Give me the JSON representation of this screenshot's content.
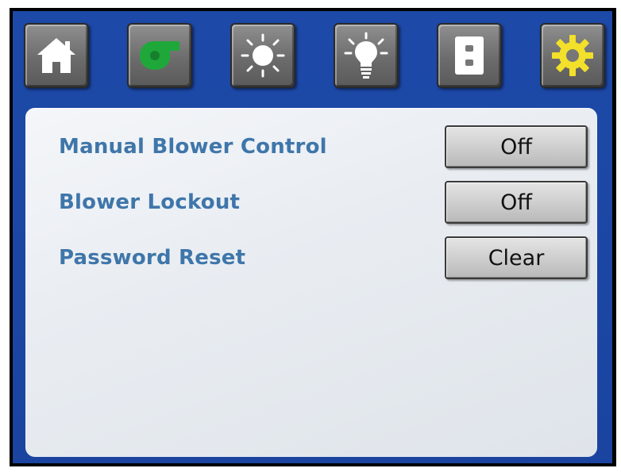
{
  "toolbar": {
    "buttons": [
      {
        "icon": "home-icon"
      },
      {
        "icon": "blower-icon",
        "color": "#1fa83a"
      },
      {
        "icon": "sun-icon"
      },
      {
        "icon": "light-bulb-icon"
      },
      {
        "icon": "outlet-icon"
      },
      {
        "icon": "gear-icon",
        "color": "#f2e02a"
      }
    ]
  },
  "settings": {
    "rows": [
      {
        "label": "Manual Blower Control",
        "value": "Off"
      },
      {
        "label": "Blower Lockout",
        "value": "Off"
      },
      {
        "label": "Password Reset",
        "value": "Clear"
      }
    ]
  },
  "colors": {
    "frame": "#1d49a8",
    "label": "#3f76aa",
    "active_blower": "#1fa83a",
    "active_gear": "#f2e02a"
  }
}
